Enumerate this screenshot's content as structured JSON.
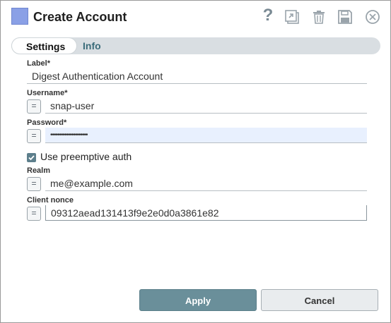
{
  "dialog": {
    "title": "Create Account",
    "help_icon": "?"
  },
  "tabs": [
    {
      "label": "Settings"
    },
    {
      "label": "Info"
    }
  ],
  "fields": {
    "label": {
      "label": "Label*",
      "value": "Digest Authentication Account"
    },
    "username": {
      "label": "Username*",
      "value": "snap-user"
    },
    "password": {
      "label": "Password*",
      "value": "•••••••••••••••••••••"
    },
    "preemptive": {
      "label": "Use preemptive auth",
      "checked": true
    },
    "realm": {
      "label": "Realm",
      "value": "me@example.com"
    },
    "client_nonce": {
      "label": "Client nonce",
      "value": "09312aead131413f9e2e0d0a3861e82"
    }
  },
  "expr_button_glyph": "=",
  "buttons": {
    "apply": "Apply",
    "cancel": "Cancel"
  },
  "colors": {
    "accent": "#6a8f9a",
    "title_swatch": "#8aa0e6",
    "password_bg": "#e8f0fe"
  },
  "icons": [
    "help-icon",
    "export-icon",
    "trash-icon",
    "save-icon",
    "close-icon",
    "checkbox-checked-icon"
  ]
}
